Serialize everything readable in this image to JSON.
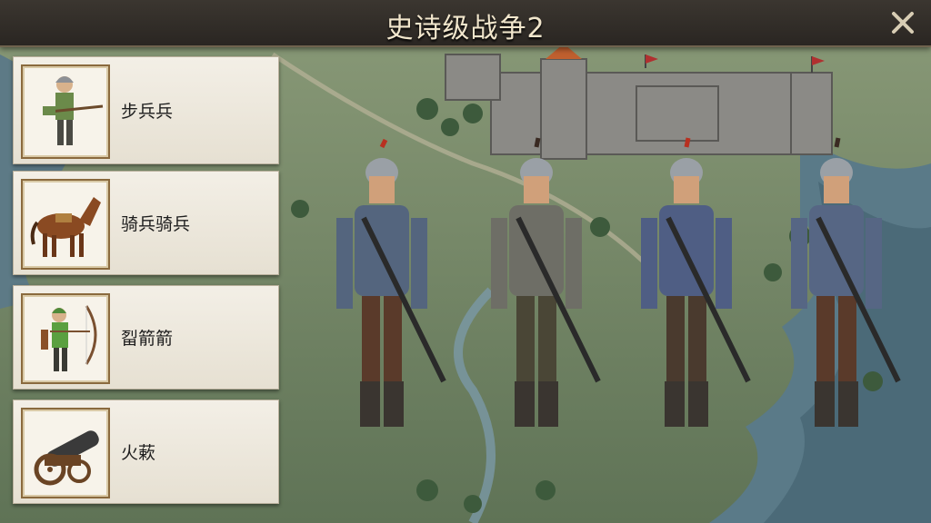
{
  "header": {
    "title": "史诗级战争2",
    "close_icon": "close-icon"
  },
  "units": [
    {
      "label": "步兵兵",
      "icon": "infantry-icon"
    },
    {
      "label": "骑兵骑兵",
      "icon": "cavalry-icon"
    },
    {
      "label": "㽝箭箭",
      "icon": "archer-icon"
    },
    {
      "label": "火蔌",
      "icon": "cannon-icon"
    }
  ],
  "colors": {
    "topbar": "#2f2b27",
    "title_text": "#f1e6cc",
    "card_bg": "#efeadf",
    "frame": "#8a6a3e"
  }
}
